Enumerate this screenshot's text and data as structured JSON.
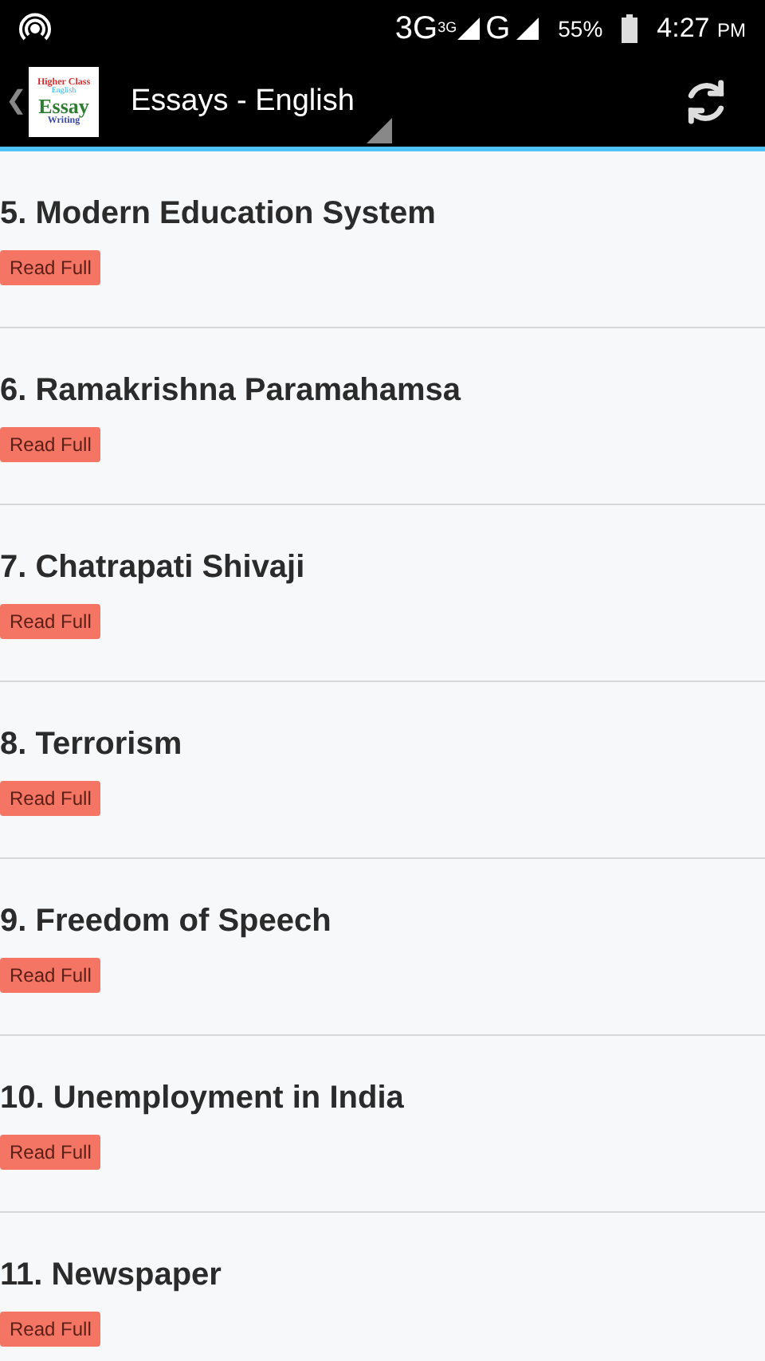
{
  "status_bar": {
    "network_1": "3G",
    "network_1_sup": "3G",
    "network_2": "G",
    "battery": "55%",
    "time": "4:27",
    "ampm": "PM"
  },
  "toolbar": {
    "back": "❮",
    "logo": [
      "Higher Class",
      "English",
      "Essay",
      "Writing"
    ],
    "title": "Essays - English"
  },
  "essays": [
    {
      "title": "5. Modern Education System",
      "button": "Read Full"
    },
    {
      "title": "6. Ramakrishna Paramahamsa",
      "button": "Read Full"
    },
    {
      "title": "7. Chatrapati Shivaji",
      "button": "Read Full"
    },
    {
      "title": "8. Terrorism",
      "button": "Read Full"
    },
    {
      "title": "9. Freedom of Speech",
      "button": "Read Full"
    },
    {
      "title": "10. Unemployment in India",
      "button": "Read Full"
    },
    {
      "title": "11. Newspaper",
      "button": "Read Full"
    }
  ]
}
